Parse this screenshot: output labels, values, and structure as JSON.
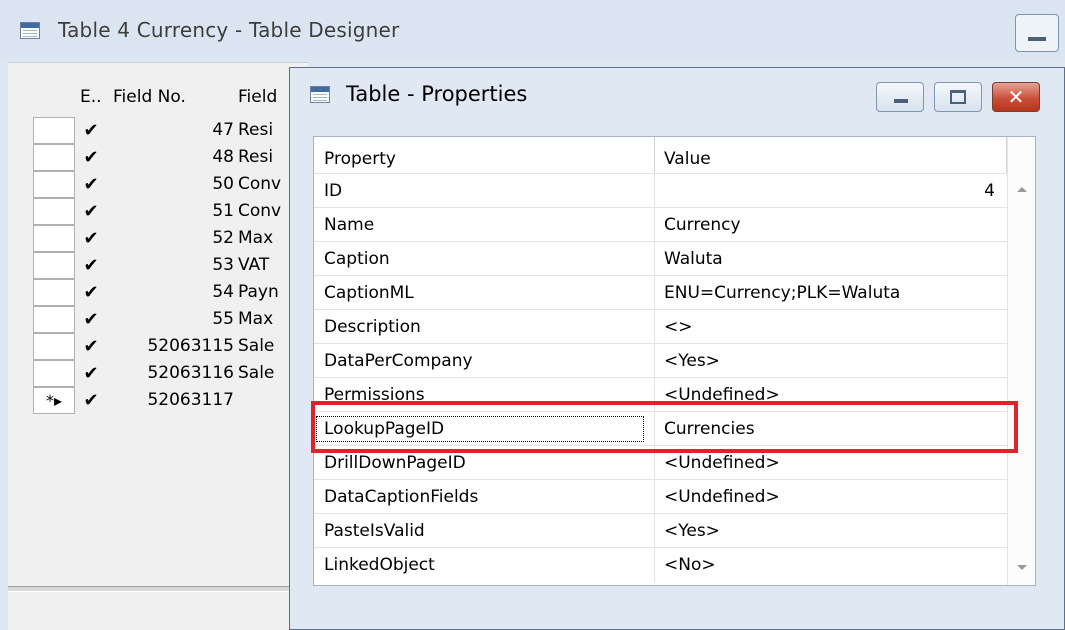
{
  "designer": {
    "title": "Table 4 Currency - Table Designer",
    "columns": {
      "enabled": "E..",
      "field_no": "Field No.",
      "field_name": "Field"
    },
    "rows": [
      {
        "enabled": "✔",
        "field_no": "47",
        "field_name": "Resi"
      },
      {
        "enabled": "✔",
        "field_no": "48",
        "field_name": "Resi"
      },
      {
        "enabled": "✔",
        "field_no": "50",
        "field_name": "Conv"
      },
      {
        "enabled": "✔",
        "field_no": "51",
        "field_name": "Conv"
      },
      {
        "enabled": "✔",
        "field_no": "52",
        "field_name": "Max"
      },
      {
        "enabled": "✔",
        "field_no": "53",
        "field_name": "VAT"
      },
      {
        "enabled": "✔",
        "field_no": "54",
        "field_name": "Payn"
      },
      {
        "enabled": "✔",
        "field_no": "55",
        "field_name": "Max"
      },
      {
        "enabled": "✔",
        "field_no": "52063115",
        "field_name": "Sale"
      },
      {
        "enabled": "✔",
        "field_no": "52063116",
        "field_name": "Sale"
      },
      {
        "enabled": "✔",
        "field_no": "52063117",
        "field_name": ""
      }
    ],
    "new_row_indicator": "*▸"
  },
  "dialog": {
    "title": "Table - Properties",
    "close_glyph": "✕",
    "columns": {
      "property": "Property",
      "value": "Value"
    },
    "rows": [
      {
        "property": "ID",
        "value": "4"
      },
      {
        "property": "Name",
        "value": "Currency"
      },
      {
        "property": "Caption",
        "value": "Waluta"
      },
      {
        "property": "CaptionML",
        "value": "ENU=Currency;PLK=Waluta"
      },
      {
        "property": "Description",
        "value": "<>"
      },
      {
        "property": "DataPerCompany",
        "value": "<Yes>"
      },
      {
        "property": "Permissions",
        "value": "<Undefined>"
      },
      {
        "property": "LookupPageID",
        "value": "Currencies"
      },
      {
        "property": "DrillDownPageID",
        "value": "<Undefined>"
      },
      {
        "property": "DataCaptionFields",
        "value": "<Undefined>"
      },
      {
        "property": "PasteIsValid",
        "value": "<Yes>"
      },
      {
        "property": "LinkedObject",
        "value": "<No>"
      }
    ],
    "selected_row": "LookupPageID",
    "highlight_color": "#e0222a"
  }
}
